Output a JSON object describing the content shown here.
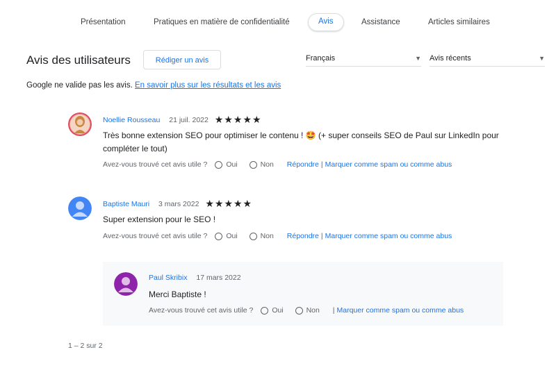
{
  "tabs": [
    {
      "label": "Présentation"
    },
    {
      "label": "Pratiques en matière de confidentialité"
    },
    {
      "label": "Avis"
    },
    {
      "label": "Assistance"
    },
    {
      "label": "Articles similaires"
    }
  ],
  "reviews_section": {
    "title": "Avis des utilisateurs",
    "write_button": "Rédiger un avis",
    "language_select": "Français",
    "sort_select": "Avis récents",
    "notice_text": "Google ne valide pas les avis.",
    "notice_link": "En savoir plus sur les résultats et les avis"
  },
  "reviews": [
    {
      "author": "Noellie Rousseau",
      "date": "21 juil. 2022",
      "rating": 5,
      "stars": "★★★★★",
      "text": "Très bonne extension SEO pour optimiser le contenu ! 🤩 (+ super conseils SEO de Paul sur LinkedIn pour compléter le tout)",
      "helpful_question": "Avez-vous trouvé cet avis utile ?",
      "yes": "Oui",
      "no": "Non",
      "reply_link": "Répondre",
      "spam_link": "Marquer comme spam ou comme abus"
    },
    {
      "author": "Baptiste Mauri",
      "date": "3 mars 2022",
      "rating": 5,
      "stars": "★★★★★",
      "text": "Super extension pour le SEO !",
      "helpful_question": "Avez-vous trouvé cet avis utile ?",
      "yes": "Oui",
      "no": "Non",
      "reply_link": "Répondre",
      "spam_link": "Marquer comme spam ou comme abus",
      "reply": {
        "author": "Paul Skribix",
        "date": "17 mars 2022",
        "text": "Merci Baptiste !",
        "helpful_question": "Avez-vous trouvé cet avis utile ?",
        "yes": "Oui",
        "no": "Non",
        "spam_link": "Marquer comme spam ou comme abus"
      }
    }
  ],
  "pagination": "1 – 2 sur 2",
  "colors": {
    "accent": "#1a73e8",
    "avatar_blue": "#4285f4",
    "avatar_purple": "#8e24aa"
  }
}
